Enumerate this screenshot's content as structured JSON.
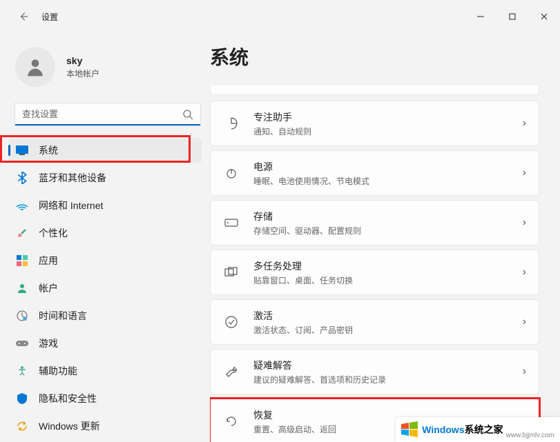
{
  "titlebar": {
    "title": "设置"
  },
  "profile": {
    "name": "sky",
    "sub": "本地帐户"
  },
  "search": {
    "placeholder": "查找设置"
  },
  "nav": [
    {
      "label": "系统",
      "icon": "system-icon",
      "active": true
    },
    {
      "label": "蓝牙和其他设备",
      "icon": "bluetooth-icon"
    },
    {
      "label": "网络和 Internet",
      "icon": "network-icon"
    },
    {
      "label": "个性化",
      "icon": "personalize-icon"
    },
    {
      "label": "应用",
      "icon": "apps-icon"
    },
    {
      "label": "帐户",
      "icon": "account-icon"
    },
    {
      "label": "时间和语言",
      "icon": "time-lang-icon"
    },
    {
      "label": "游戏",
      "icon": "gaming-icon"
    },
    {
      "label": "辅助功能",
      "icon": "accessibility-icon"
    },
    {
      "label": "隐私和安全性",
      "icon": "privacy-icon"
    },
    {
      "label": "Windows 更新",
      "icon": "update-icon"
    }
  ],
  "page": {
    "title": "系统"
  },
  "cards": [
    {
      "title": "专注助手",
      "sub": "通知、自动规则",
      "icon": "focus-icon"
    },
    {
      "title": "电源",
      "sub": "睡眠、电池使用情况、节电模式",
      "icon": "power-icon"
    },
    {
      "title": "存储",
      "sub": "存储空间、驱动器、配置规则",
      "icon": "storage-icon"
    },
    {
      "title": "多任务处理",
      "sub": "贴靠窗口、桌面、任务切换",
      "icon": "multitask-icon"
    },
    {
      "title": "激活",
      "sub": "激活状态、订阅、产品密钥",
      "icon": "activation-icon"
    },
    {
      "title": "疑难解答",
      "sub": "建议的疑难解答、首选项和历史记录",
      "icon": "troubleshoot-icon"
    },
    {
      "title": "恢复",
      "sub": "重置、高级启动、返回",
      "icon": "recovery-icon"
    }
  ],
  "watermark": {
    "text1": "Windows",
    "text2": "系统之家",
    "url": "www.bjjmlv.com"
  },
  "highlights": {
    "nav_system": true,
    "card_recovery": true
  }
}
